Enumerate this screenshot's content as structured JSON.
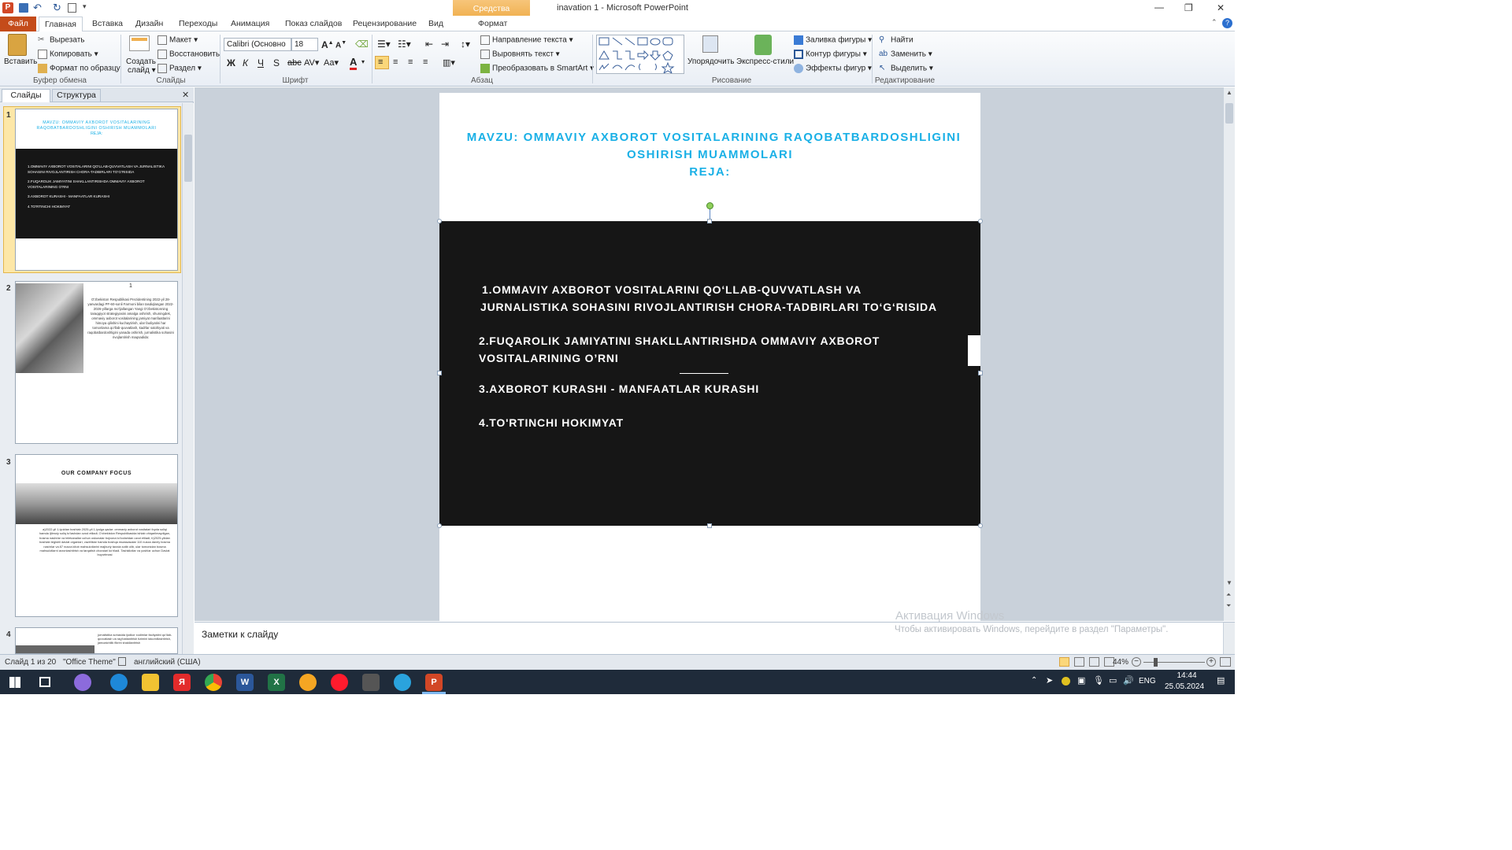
{
  "window": {
    "title": "inavation 1 - Microsoft PowerPoint",
    "context_tab_group": "Средства рисования",
    "controls": {
      "minimize": "—",
      "maximize": "❐",
      "close": "✕"
    }
  },
  "ribbon_tabs": [
    "Файл",
    "Главная",
    "Вставка",
    "Дизайн",
    "Переходы",
    "Анимация",
    "Показ слайдов",
    "Рецензирование",
    "Вид",
    "Формат"
  ],
  "ribbon": {
    "clipboard": {
      "paste": "Вставить",
      "cut": "Вырезать",
      "copy": "Копировать",
      "format_painter": "Формат по образцу",
      "label": "Буфер обмена"
    },
    "slides": {
      "new_slide_1": "Создать",
      "new_slide_2": "слайд",
      "layout": "Макет",
      "reset": "Восстановить",
      "section": "Раздел",
      "label": "Слайды"
    },
    "font": {
      "name": "Calibri (Основно",
      "size": "18",
      "label": "Шрифт"
    },
    "paragraph": {
      "text_direction": "Направление текста",
      "align_text": "Выровнять текст",
      "smartart": "Преобразовать в SmartArt",
      "label": "Абзац"
    },
    "drawing": {
      "arrange": "Упорядочить",
      "quick_styles": "Экспресс-стили",
      "shape_fill": "Заливка фигуры",
      "shape_outline": "Контур фигуры",
      "shape_effects": "Эффекты фигур",
      "label": "Рисование"
    },
    "editing": {
      "find": "Найти",
      "replace": "Заменить",
      "select": "Выделить",
      "label": "Редактирование"
    }
  },
  "panel": {
    "tab_slides": "Слайды",
    "tab_outline": "Структура",
    "close": "✕"
  },
  "thumbnails": [
    {
      "num": "1",
      "title": "MAVZU: OMMAVIY AXBOROT VOSITALARINING RAQOBATBARDOSHLIGINI OSHIRISH MUAMMOLARI",
      "sub": "REJA:",
      "lines": [
        "1.OMMAVIY AXBOROT VOSITALARINI QO‘LLAB-QUVVATLASH VA JURNALISTIKA SOHASINI RIVOJLANTIRISH CHORA-TADBIRLARI TO‘G‘RISIDA",
        "2.FUQAROLIK JAMIYATINI SHAKLLANTIRISHDA OMMAVIY AXBOROT VOSITALARINING O’RNI",
        "3.AXBOROT KURASHI - MANFAATLAR KURASHI",
        "4.TO'RTINCHI HOKIMYAT"
      ]
    },
    {
      "num": "2",
      "page": "1",
      "text": "O‘zbekiston Respublikasi Prezidentining 2022-yil 28-yanvardagi PF-60-sonli Farmoni bilan tasdiqlangan 2022-2026-yillarga mo‘ljallangan Yangi O‘zbekistonning taraqqiyot strategiyasini amalga oshirish, shuningdek, ommaviy axborot vositalarining jamiyat manfaatlarini himoya qilishini kuchaytirish, ular faoliyatini har tomonlama qo‘llab-quvvatlash, kadrlar salohiyati va raqobatbardoshligini yanada oshirish, jurnalistika sohasini rivojlantirish maqsadida:"
    },
    {
      "num": "3",
      "title": "OUR COMPANY FOCUS",
      "text": "a)2022-yil 1-iyuldan boshlab 2025-yil 1-iyulga qadar: ommaviy axborot vositalari foyda soliqi hamda ijtimoiy soliq to‘lashdan ozod etiladi; O‘zbekiston Respublikasida ishlab chiqarilmaydigan, bosma nashrlar va telekanallar uchun uskunalar bojxona to‘lovlaridan ozod etiladi; b)2025-yildan boshlab tegishli davlat organlari, vazirliklar hamda boshqa muassasalar 110 nusxa davriy bosma nashrlar va 87 nusxa kitob mahsulotlarini majburiy tarzda sotib olib, ular tomonidan bosma mahsulotlarni arzonlashtirish va tarqatish choralari ko‘riladi. Tashkilotlar va yoshlar uchun Davlat buyurtmasi"
    },
    {
      "num": "4",
      "text": "jurnalistika sohasida ijodkor xodimlar faoliyatini qo‘llab-quvvatlash va rag‘batlantirish tizimini takomillashtirish, jamoatchilik fikrini shakllantirish"
    }
  ],
  "slide": {
    "title_line1": "MAVZU: OMMAVIY AXBOROT VOSITALARINING RAQOBATBARDOSHLIGINI",
    "title_line2": "OSHIRISH MUAMMOLARI",
    "subtitle": "REJA:",
    "items": [
      {
        "line1": "1.OMMAVIY  AXBOROT  VOSITALARINI QO‘LLAB-QUVVATLASH VA",
        "line2": "JURNALISTIKA SOHASINI RIVOJLANTIRISH CHORA-TADBIRLARI TO‘G‘RISIDA"
      },
      {
        "line1": "2.FUQAROLIK JAMIYATINI SHAKLLANTIRISHDA OMMAVIY AXBOROT",
        "line2": "VOSITALARINING O’RNI"
      },
      {
        "line1": "3.AXBOROT KURASHI - MANFAATLAR KURASHI",
        "line2": ""
      },
      {
        "line1": "4.TO'RTINCHI HOKIMYAT",
        "line2": ""
      }
    ],
    "title_color": "#1ab0e6",
    "box_color": "#161616"
  },
  "notes_placeholder": "Заметки к слайду",
  "activation": {
    "line1": "Активация Windows",
    "line2": "Чтобы активировать Windows, перейдите в раздел \"Параметры\"."
  },
  "status": {
    "slide": "Слайд 1 из 20",
    "theme": "\"Office Theme\"",
    "lang": "английский (США)",
    "zoom": "44%"
  },
  "taskbar": {
    "lang": "ENG",
    "time": "14:44",
    "date": "25.05.2024"
  }
}
